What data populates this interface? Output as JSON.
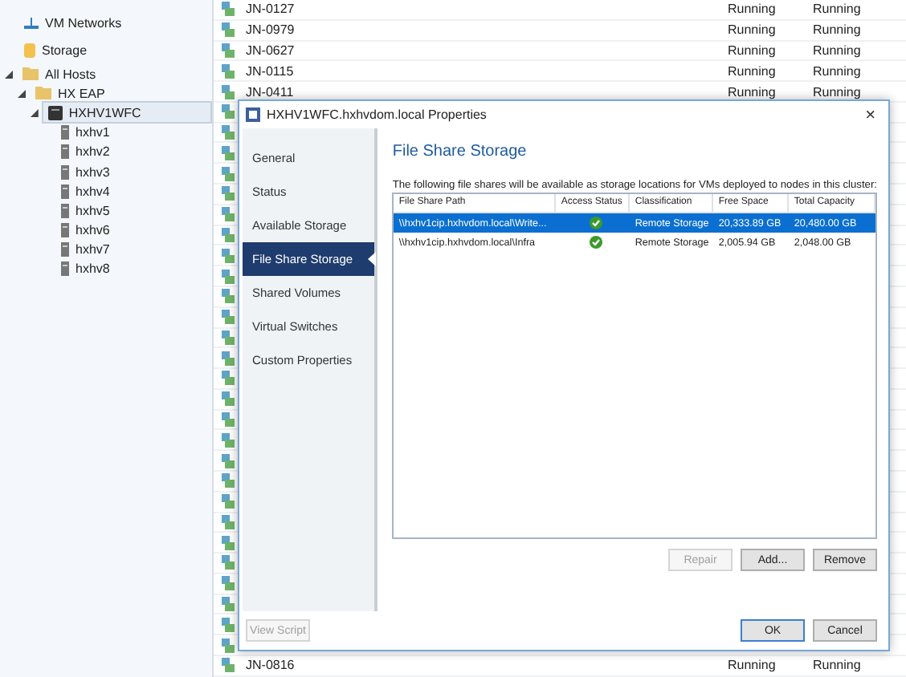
{
  "navigation_tree": {
    "items": [
      {
        "label": "VM Networks",
        "kind": "network",
        "selected": false
      },
      {
        "label": "Storage",
        "kind": "storage",
        "selected": false
      },
      {
        "label": "All Hosts",
        "kind": "folder",
        "selected": false,
        "expanded": true,
        "children": [
          {
            "label": "HX EAP",
            "kind": "folder",
            "selected": false,
            "expanded": true,
            "children": [
              {
                "label": "HXHV1WFC",
                "kind": "cluster",
                "selected": true,
                "expanded": true,
                "children": [
                  {
                    "label": "hxhv1",
                    "kind": "host",
                    "selected": false
                  },
                  {
                    "label": "hxhv2",
                    "kind": "host",
                    "selected": false
                  },
                  {
                    "label": "hxhv3",
                    "kind": "host",
                    "selected": false
                  },
                  {
                    "label": "hxhv4",
                    "kind": "host",
                    "selected": false
                  },
                  {
                    "label": "hxhv5",
                    "kind": "host",
                    "selected": false
                  },
                  {
                    "label": "hxhv6",
                    "kind": "host",
                    "selected": false
                  },
                  {
                    "label": "hxhv7",
                    "kind": "host",
                    "selected": false
                  },
                  {
                    "label": "hxhv8",
                    "kind": "host",
                    "selected": false
                  }
                ]
              }
            ]
          }
        ]
      }
    ]
  },
  "vm_list": {
    "top_rows": [
      {
        "name": "JN-0127",
        "column_2": "Running",
        "column_3": "Running"
      },
      {
        "name": "JN-0979",
        "column_2": "Running",
        "column_3": "Running"
      },
      {
        "name": "JN-0627",
        "column_2": "Running",
        "column_3": "Running"
      },
      {
        "name": "JN-0115",
        "column_2": "Running",
        "column_3": "Running"
      },
      {
        "name": "JN-0411",
        "column_2": "Running",
        "column_3": "Running"
      }
    ],
    "bottom_rows": [
      {
        "name": "JN-0816",
        "column_2": "Running",
        "column_3": "Running"
      }
    ]
  },
  "dialog": {
    "title": "HXHV1WFC.hxhvdom.local Properties",
    "close": "×",
    "nav": [
      {
        "label": "General",
        "selected": false
      },
      {
        "label": "Status",
        "selected": false
      },
      {
        "label": "Available Storage",
        "selected": false
      },
      {
        "label": "File Share Storage",
        "selected": true
      },
      {
        "label": "Shared Volumes",
        "selected": false
      },
      {
        "label": "Virtual Switches",
        "selected": false
      },
      {
        "label": "Custom Properties",
        "selected": false
      }
    ],
    "heading": "File Share Storage",
    "description": "The following file shares will be available as storage locations for VMs deployed to nodes in this cluster:",
    "table": {
      "columns": [
        "File Share Path",
        "Access Status",
        "Classification",
        "Free Space",
        "Total Capacity"
      ],
      "rows": [
        {
          "selected": true,
          "path": "\\\\hxhv1cip.hxhvdom.local\\Write...",
          "classification": "Remote Storage",
          "free_space": "20,333.89 GB",
          "total_capacity": "20,480.00 GB"
        },
        {
          "selected": false,
          "path": "\\\\hxhv1cip.hxhvdom.local\\Infra",
          "classification": "Remote Storage",
          "free_space": "2,005.94 GB",
          "total_capacity": "2,048.00 GB"
        }
      ]
    },
    "table_buttons": [
      {
        "label": "Repair",
        "disabled": true
      },
      {
        "label": "Add...",
        "disabled": false
      },
      {
        "label": "Remove",
        "disabled": false
      }
    ],
    "view_script": {
      "label": "View Script",
      "disabled": true
    },
    "footer_buttons": [
      {
        "label": "OK",
        "default": true
      },
      {
        "label": "Cancel",
        "default": false
      }
    ]
  }
}
